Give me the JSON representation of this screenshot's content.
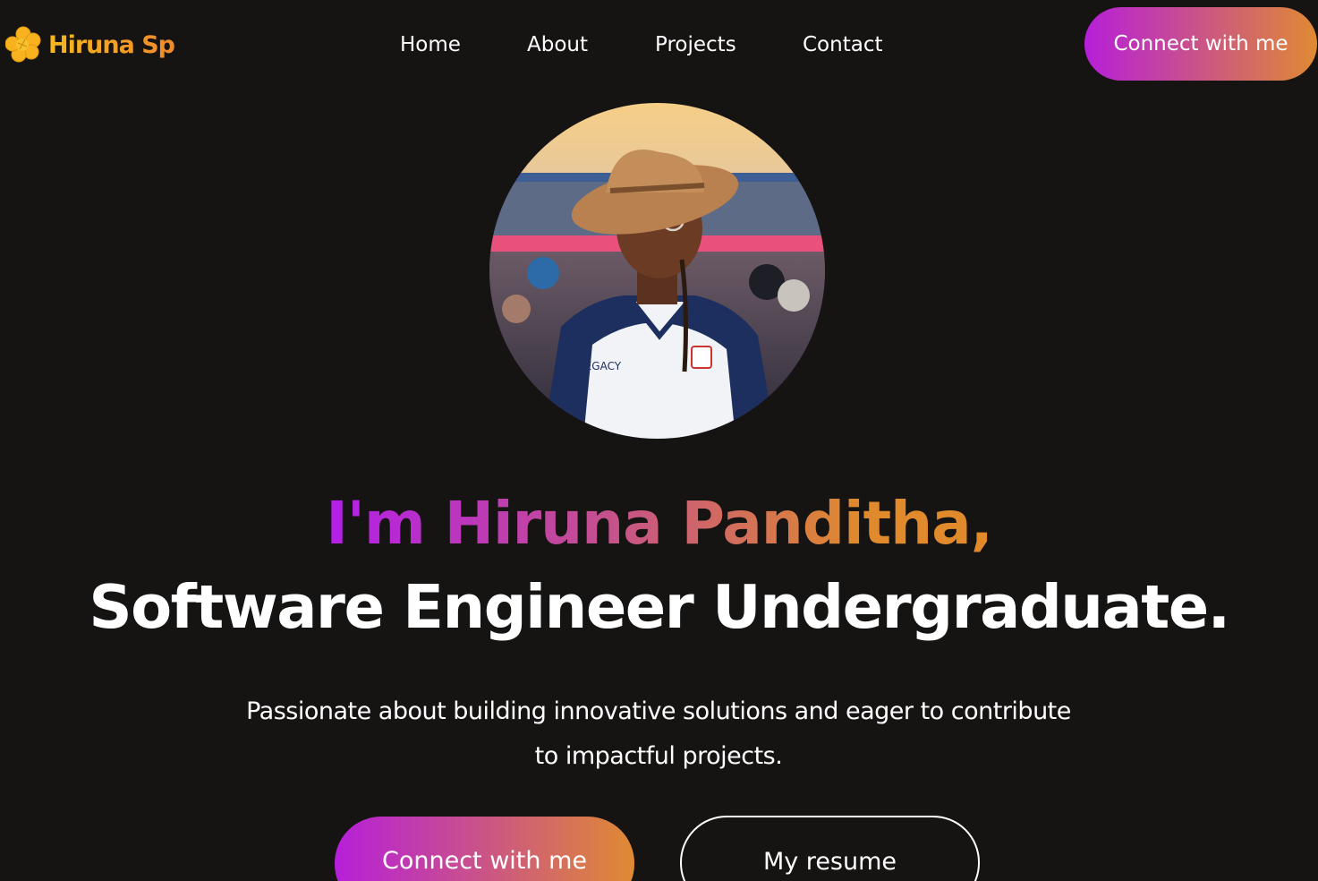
{
  "brand": {
    "name": "Hiruna Sp",
    "logo_icon": "flower-icon",
    "colors": {
      "logo": "#f7b21d",
      "logo_text": "#f08a2a"
    }
  },
  "nav": {
    "items": [
      {
        "label": "Home"
      },
      {
        "label": "About"
      },
      {
        "label": "Projects"
      },
      {
        "label": "Contact"
      }
    ],
    "cta_label": "Connect with me"
  },
  "hero": {
    "avatar_icon": "profile-photo",
    "greeting": "I'm Hiruna Panditha,",
    "role": "Software Engineer Undergraduate.",
    "tagline_line1": "Passionate about building innovative solutions and eager to contribute",
    "tagline_line2": "to impactful projects.",
    "primary_button": "Connect with me",
    "secondary_button": "My resume"
  },
  "colors": {
    "background": "#161313",
    "gradient_start": "#b61fd9",
    "gradient_end": "#df8a33",
    "text": "#ffffff"
  }
}
